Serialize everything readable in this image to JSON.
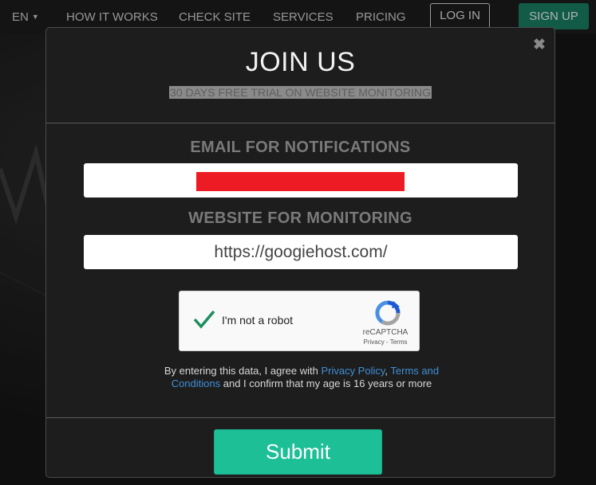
{
  "nav": {
    "language": "EN",
    "items": [
      "HOW IT WORKS",
      "CHECK SITE",
      "SERVICES",
      "PRICING"
    ],
    "login_label": "LOG IN",
    "signup_label": "SIGN UP"
  },
  "modal": {
    "title": "JOIN US",
    "subtitle": "30 DAYS FREE TRIAL ON WEBSITE MONITORING",
    "email_label": "EMAIL FOR NOTIFICATIONS",
    "email_value": "",
    "website_label": "WEBSITE FOR MONITORING",
    "website_value": "https://googiehost.com/",
    "captcha": {
      "label": "I'm not a robot",
      "brand": "reCAPTCHA",
      "links": "Privacy - Terms",
      "checked": true
    },
    "consent": {
      "prefix": "By entering this data, I agree with ",
      "privacy": "Privacy Policy",
      "separator": ", ",
      "terms": "Terms and Conditions",
      "suffix": " and I confirm that my age is 16 years or more"
    },
    "submit_label": "Submit"
  },
  "colors": {
    "submit_bg": "#1dbf97",
    "signup_bg": "#187a5f",
    "link": "#3f8fd6",
    "redaction": "#ed1c24"
  },
  "icons": {
    "close": "close-icon",
    "caret": "caret-down-icon",
    "captcha_check": "checkmark-icon",
    "captcha_logo": "recaptcha-logo-icon"
  }
}
